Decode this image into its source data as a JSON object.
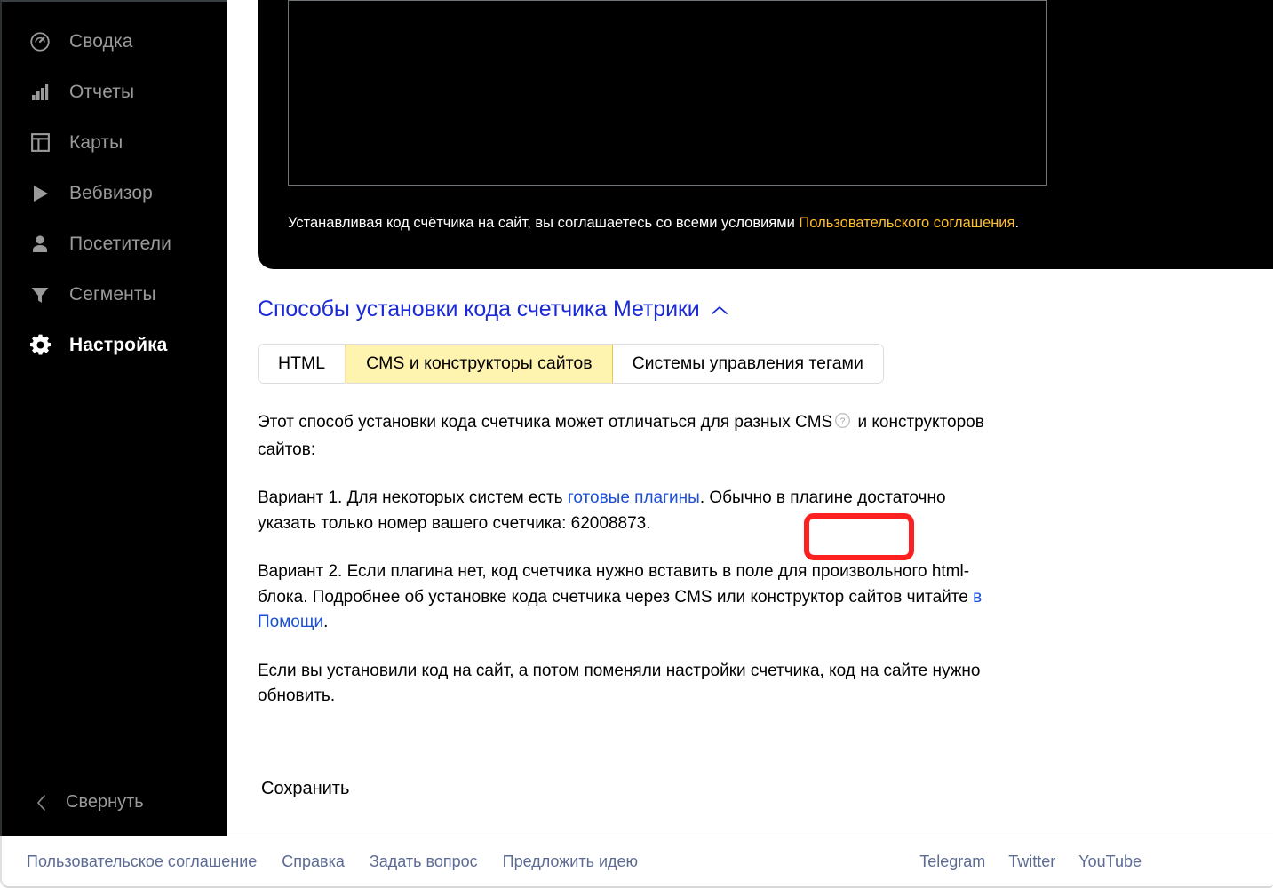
{
  "sidebar": {
    "items": [
      {
        "icon": "gauge-icon",
        "label": "Сводка",
        "key": "summary",
        "active": false
      },
      {
        "icon": "bar-chart-icon",
        "label": "Отчеты",
        "key": "reports",
        "active": false
      },
      {
        "icon": "layout-icon",
        "label": "Карты",
        "key": "maps",
        "active": false
      },
      {
        "icon": "play-icon",
        "label": "Вебвизор",
        "key": "webvisor",
        "active": false
      },
      {
        "icon": "user-icon",
        "label": "Посетители",
        "key": "visitors",
        "active": false
      },
      {
        "icon": "funnel-icon",
        "label": "Сегменты",
        "key": "segments",
        "active": false
      },
      {
        "icon": "gear-icon",
        "label": "Настройка",
        "key": "settings",
        "active": true
      }
    ],
    "collapse": {
      "icon": "chevron-left-icon",
      "label": "Свернуть"
    }
  },
  "code_panel": {
    "code_value": "",
    "note_prefix": "Устанавливая код счётчика на сайт, вы соглашаетесь со всеми условиями ",
    "note_link": "Пользовательского соглашения",
    "note_suffix": "."
  },
  "section": {
    "title": "Способы установки кода счетчика Метрики",
    "caret": "⌃",
    "tabs": [
      {
        "label": "HTML",
        "selected": false
      },
      {
        "label": "CMS и конструкторы сайтов",
        "selected": true
      },
      {
        "label": "Системы управления тегами",
        "selected": false
      }
    ],
    "paragraph_1_a": "Этот способ установки кода счетчика может отличаться для разных CMS",
    "help_icon": "help-circle-icon",
    "paragraph_1_b": " и конструкторов сайтов:",
    "paragraph_2_a": "Вариант 1. Для некоторых систем есть ",
    "paragraph_2_link": "готовые плагины",
    "paragraph_2_b": ". Обычно в плагине достаточно указать только номер вашего счетчика: ",
    "counter_number": "62008873",
    "paragraph_2_c": ".",
    "paragraph_3_a": "Вариант 2. Если плагина нет, код счетчика нужно вставить в поле для произвольного html-блока. Подробнее об установке кода счетчика через CMS или конструктор сайтов читайте ",
    "paragraph_3_link": "в Помощи",
    "paragraph_3_b": ".",
    "paragraph_4": "Если вы установили код на сайт, а потом поменяли настройки счетчика, код на сайте нужно обновить.",
    "save_label": "Сохранить"
  },
  "annotation": {
    "name": "counter-number-highlight",
    "color": "#fd2020"
  },
  "footer": {
    "left_links": [
      "Пользовательское соглашение",
      "Справка",
      "Задать вопрос",
      "Предложить идею"
    ],
    "right_links": [
      "Telegram",
      "Twitter",
      "YouTube"
    ]
  },
  "colors": {
    "sidebar_bg": "#000000",
    "accent_link": "#1b2ad6",
    "tab_selected_bg": "#fff3b0",
    "note_link": "#ffbe2e",
    "annotation_red": "#fd2020",
    "footer_link": "#5d6b92"
  }
}
